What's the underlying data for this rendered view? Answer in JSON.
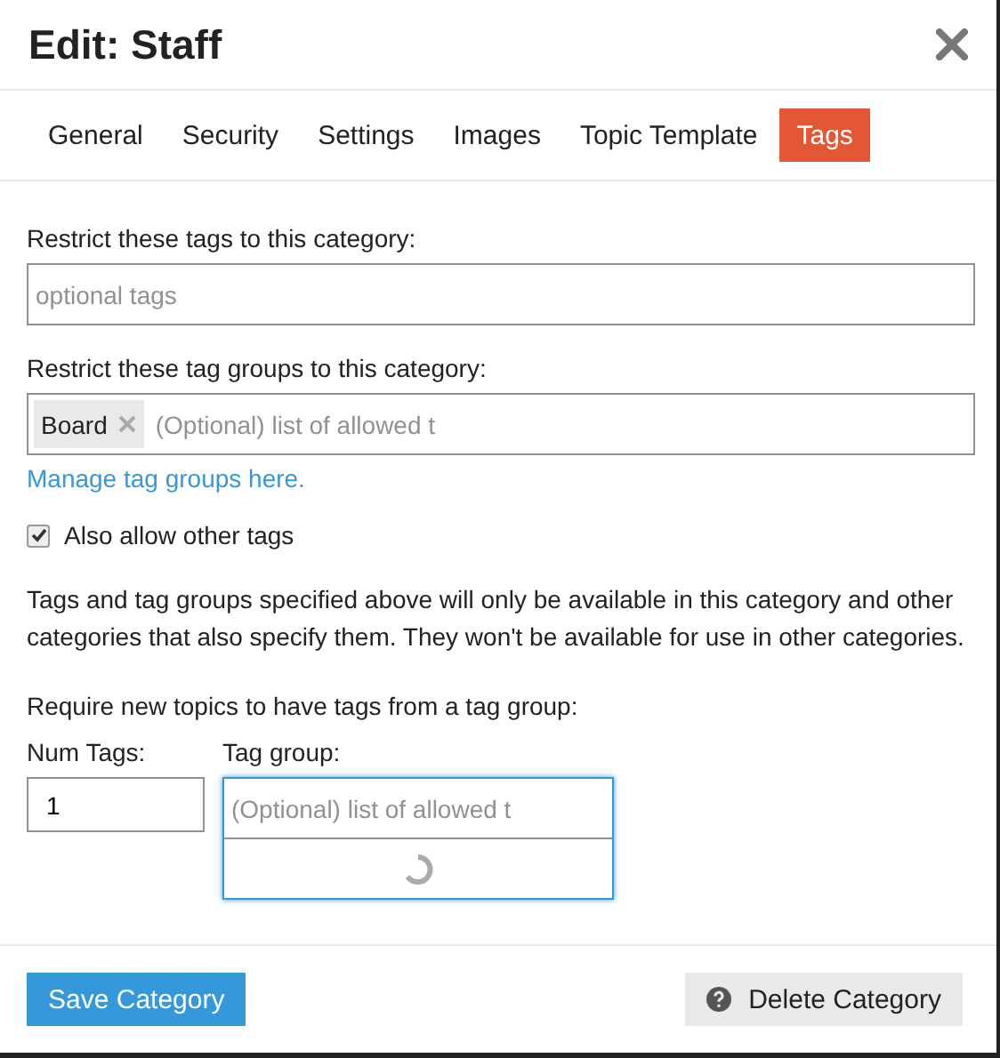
{
  "window": {
    "title": "Edit: Staff"
  },
  "tabs": [
    {
      "label": "General",
      "selected": false
    },
    {
      "label": "Security",
      "selected": false
    },
    {
      "label": "Settings",
      "selected": false
    },
    {
      "label": "Images",
      "selected": false
    },
    {
      "label": "Topic Template",
      "selected": false
    },
    {
      "label": "Tags",
      "selected": true
    }
  ],
  "restrict_tags": {
    "label": "Restrict these tags to this category:",
    "placeholder": "optional tags"
  },
  "restrict_tag_groups": {
    "label": "Restrict these tag groups to this category:",
    "chips": [
      "Board"
    ],
    "placeholder": "(Optional) list of allowed t"
  },
  "manage_link": "Manage tag groups here.",
  "allow_other": {
    "label": "Also allow other tags",
    "checked": true
  },
  "description": "Tags and tag groups specified above will only be available in this category and other categories that also specify them. They won't be available for use in other categories.",
  "require_label": "Require new topics to have tags from a tag group:",
  "num_tags": {
    "label": "Num Tags:",
    "value": "1"
  },
  "tag_group": {
    "label": "Tag group:",
    "placeholder": "(Optional) list of allowed t",
    "loading": true
  },
  "buttons": {
    "save": "Save Category",
    "delete": "Delete Category"
  }
}
